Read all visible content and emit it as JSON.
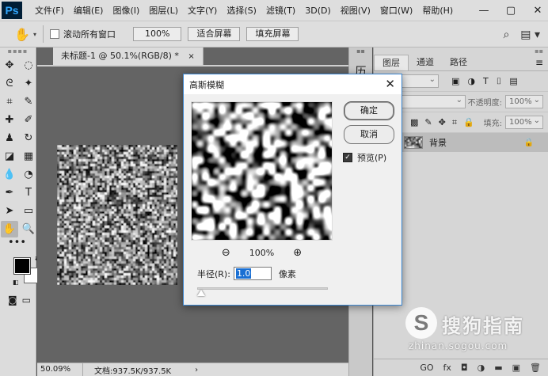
{
  "app": {
    "logo": "Ps"
  },
  "menu": [
    "文件(F)",
    "编辑(E)",
    "图像(I)",
    "图层(L)",
    "文字(Y)",
    "选择(S)",
    "滤镜(T)",
    "3D(D)",
    "视图(V)",
    "窗口(W)",
    "帮助(H)"
  ],
  "window_controls": {
    "minimize": "—",
    "restore": "▢",
    "close": "✕"
  },
  "options_bar": {
    "scroll_all_label": "滚动所有窗口",
    "zoom_button": "100%",
    "fit_screen_button": "适合屏幕",
    "fill_screen_button": "填充屏幕"
  },
  "document": {
    "tab_title": "未标题-1 @ 50.1%(RGB/8) *",
    "tab_close": "×",
    "status_zoom": "50.09%",
    "status_doc": "文档:937.5K/937.5K",
    "status_arrow": "›"
  },
  "history_panel": {
    "icon_label": "历"
  },
  "layers_panel": {
    "tabs": [
      "图层",
      "通道",
      "路径"
    ],
    "kind_filter": "类型",
    "opacity_label": "不透明度:",
    "opacity_value": "100%",
    "fill_label": "填充:",
    "fill_value": "100%",
    "layer_name": "背景",
    "footer_icons": [
      "GO",
      "fx",
      "◘",
      "◑",
      "▬",
      "▣",
      "🗑"
    ]
  },
  "dialog": {
    "title": "高斯模糊",
    "ok_button": "确定",
    "cancel_button": "取消",
    "preview_label": "预览(P)",
    "preview_checked": true,
    "zoom_out": "⊖",
    "zoom_level": "100%",
    "zoom_in": "⊕",
    "radius_label": "半径(R):",
    "radius_value": "1.0",
    "radius_unit": "像素",
    "radius_slider_fraction": 0.02
  },
  "watermark": {
    "logo_char": "S",
    "name": "搜狗指南",
    "url": "zhinan.sogou.com"
  },
  "colors": {
    "foreground": "#000000",
    "background": "#ffffff",
    "accent": "#1a6fd3"
  }
}
